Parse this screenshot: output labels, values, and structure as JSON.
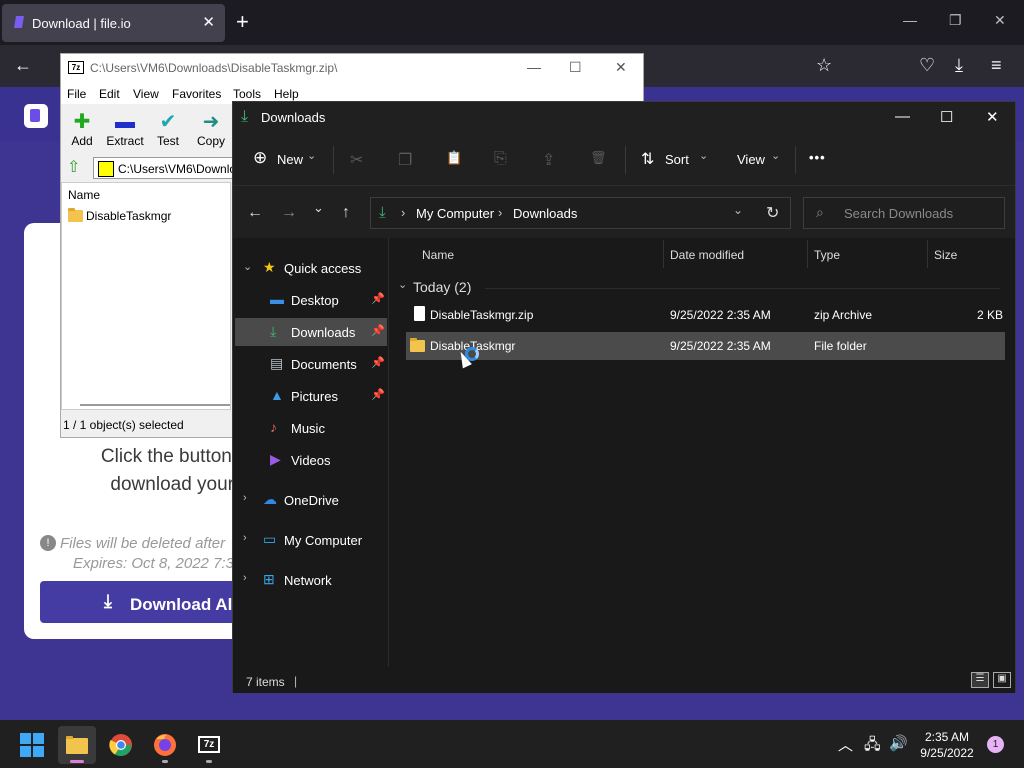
{
  "browser": {
    "tab_title": "Download | file.io",
    "tab_close_glyph": "✕",
    "new_tab_glyph": "+",
    "window_min": "—",
    "window_max": "❐",
    "window_close": "✕",
    "back_glyph": "←",
    "star_glyph": "☆",
    "pocket_glyph": "♡",
    "download_glyph": "⤓",
    "menu_glyph": "≡"
  },
  "webpage": {
    "line1": "Click the button belo",
    "line2": "download your file",
    "note1": "Files will be deleted after",
    "note2": "Expires: Oct 8, 2022 7:3",
    "download_btn": "Download All",
    "download_glyph": "⤓"
  },
  "sevenzip": {
    "title": "C:\\Users\\VM6\\Downloads\\DisableTaskmgr.zip\\",
    "logo": "7z",
    "menu": [
      "File",
      "Edit",
      "View",
      "Favorites",
      "Tools",
      "Help"
    ],
    "tools": [
      {
        "label": "Add",
        "icon": "add-icon",
        "glyph": "✚",
        "color": "#1ea91e"
      },
      {
        "label": "Extract",
        "icon": "extract-icon",
        "glyph": "▬",
        "color": "#1f2fcc"
      },
      {
        "label": "Test",
        "icon": "test-icon",
        "glyph": "✔",
        "color": "#1aa9b0"
      },
      {
        "label": "Copy",
        "icon": "copy-icon",
        "glyph": "➜",
        "color": "#1e8d86"
      }
    ],
    "address": "C:\\Users\\VM6\\Downlo",
    "column_name": "Name",
    "item": "DisableTaskmgr",
    "status": "1 / 1 object(s) selected",
    "up_glyph": "⇧",
    "win_min": "—",
    "win_max": "☐",
    "win_close": "✕"
  },
  "explorer": {
    "title": "Downloads",
    "title_icon_glyph": "⤓",
    "win_min": "—",
    "win_max": "☐",
    "win_close": "✕",
    "cmd": {
      "new_label": "New",
      "new_glyph": "⊕",
      "sort_label": "Sort",
      "sort_glyph": "⇅",
      "view_label": "View",
      "more_glyph": "•••",
      "chevron": "⌄",
      "cut_glyph": "✂",
      "copy_glyph": "❐",
      "paste_glyph": "📋",
      "rename_glyph": "⎘",
      "share_glyph": "⇪",
      "delete_glyph": "🗑"
    },
    "nav": {
      "back": "←",
      "forward": "→",
      "recent": "⌄",
      "up": "↑",
      "crumb_sep": "›",
      "crumb1": "My Computer",
      "crumb2": "Downloads",
      "addr_icon": "⤓",
      "addr_dropdown": "⌄",
      "refresh": "↻",
      "search_placeholder": "Search Downloads",
      "search_glyph": "⌕"
    },
    "nav_pane": {
      "quick_access": "Quick access",
      "items": [
        {
          "label": "Desktop",
          "glyph": "▬",
          "color": "#3a8ee6",
          "pinned": true
        },
        {
          "label": "Downloads",
          "glyph": "⤓",
          "color": "#3dbb7a",
          "pinned": true
        },
        {
          "label": "Documents",
          "glyph": "▤",
          "color": "#b8c2cc",
          "pinned": true
        },
        {
          "label": "Pictures",
          "glyph": "▲",
          "color": "#3a9ee6",
          "pinned": true
        },
        {
          "label": "Music",
          "glyph": "♪",
          "color": "#e0705a",
          "pinned": false
        },
        {
          "label": "Videos",
          "glyph": "▶",
          "color": "#9a5ae6",
          "pinned": false
        }
      ],
      "onedrive": "OneDrive",
      "my_computer": "My Computer",
      "network": "Network",
      "pin_glyph": "📌",
      "expand_glyph": "›",
      "collapse_glyph": "⌄",
      "star_glyph": "★",
      "cloud_glyph": "☁",
      "pc_glyph": "▭",
      "net_glyph": "⊞"
    },
    "columns": {
      "name": "Name",
      "date": "Date modified",
      "type": "Type",
      "size": "Size"
    },
    "group": "Today (2)",
    "group_glyph": "⌄",
    "files": [
      {
        "name": "DisableTaskmgr.zip",
        "date": "9/25/2022 2:35 AM",
        "type": "zip Archive",
        "size": "2 KB"
      },
      {
        "name": "DisableTaskmgr",
        "date": "9/25/2022 2:35 AM",
        "type": "File folder",
        "size": ""
      }
    ],
    "status": "7 items",
    "status_sep": "|",
    "details_glyph": "☰",
    "tiles_glyph": "▣"
  },
  "taskbar": {
    "clock_time": "2:35 AM",
    "clock_date": "9/25/2022",
    "notifications": "1",
    "sevenzip_label": "7z",
    "chevron_up": "︿",
    "network_glyph": "🖧",
    "volume_glyph": "🔊"
  }
}
